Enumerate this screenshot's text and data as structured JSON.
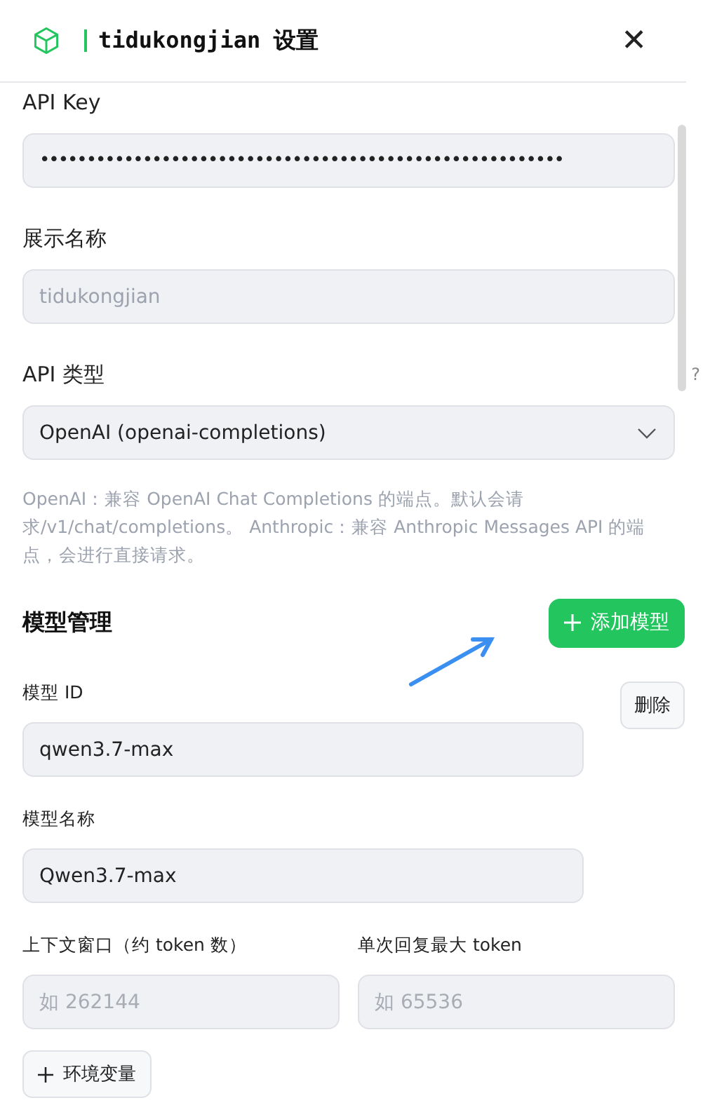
{
  "header": {
    "title": "tidukongjian 设置",
    "close": "✕"
  },
  "fields": [
    {
      "label": "API Key",
      "value": "••••••••••••••••••••••••••••••••••••••••••••••••••••••••",
      "kind": "text"
    },
    {
      "label": "展示名称",
      "placeholder": "tidukongjian",
      "kind": "text"
    },
    {
      "label": "API 类型",
      "hint": "?",
      "value": "OpenAI (openai-completions)",
      "kind": "select"
    }
  ],
  "help_text": "OpenAI：兼容 OpenAI Chat Completions 的端点。默认会请求/v1/chat/completions。 Anthropic：兼容 Anthropic Messages API 的端点，会进行直接请求。",
  "models": {
    "title": "模型管理",
    "add_button": "添加模型",
    "delete_button": "删除",
    "id_field": {
      "label": "模型 ID",
      "value": "qwen3.7-max"
    },
    "name_field": {
      "label": "模型名称",
      "value": "Qwen3.7-max"
    },
    "context_field": {
      "label": "上下文窗口（约 token 数）",
      "placeholder": "如 262144"
    },
    "max_tokens_field": {
      "label": "单次回复最大 token",
      "placeholder": "如 65536"
    },
    "env_button": "环境变量"
  }
}
